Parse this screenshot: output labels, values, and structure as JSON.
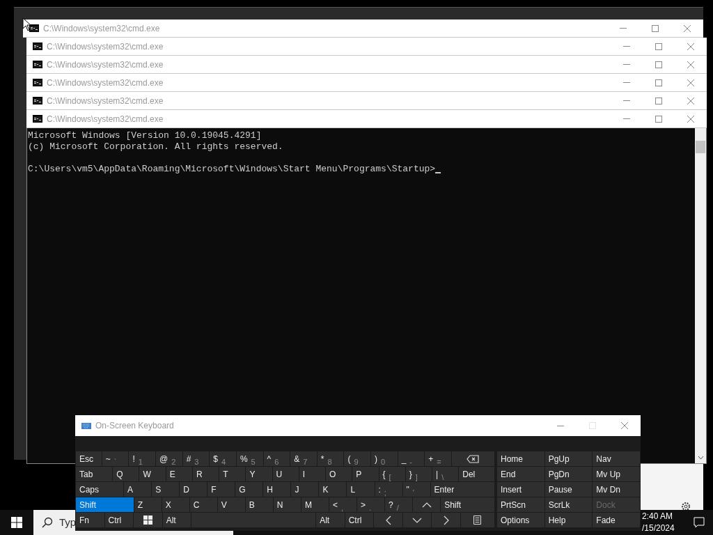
{
  "cmd_windows": [
    {
      "title": "C:\\Windows\\system32\\cmd.exe"
    },
    {
      "title": "C:\\Windows\\system32\\cmd.exe"
    },
    {
      "title": "C:\\Windows\\system32\\cmd.exe"
    },
    {
      "title": "C:\\Windows\\system32\\cmd.exe"
    },
    {
      "title": "C:\\Windows\\system32\\cmd.exe"
    },
    {
      "title": "C:\\Windows\\system32\\cmd.exe"
    }
  ],
  "console": {
    "blocks": [
      [
        "Microsoft Windows [Version 10.0.19045.4291]",
        "(c) Microsoft Corporation. All rights reserved."
      ],
      [
        "C:\\Users\\vm5\\AppData\\Roaming\\Microsoft\\Windows\\Start Menu\\Programs\\Startup>"
      ]
    ]
  },
  "keyboard": {
    "title": "On-Screen Keyboard",
    "key_rows": [
      {
        "keys": [
          {
            "kind": "text",
            "label": "Esc",
            "selected": false
          },
          {
            "kind": "text",
            "label": "~",
            "sub": "`",
            "selected": false
          },
          {
            "kind": "text",
            "label": "!",
            "sub": "1",
            "selected": false
          },
          {
            "kind": "text",
            "label": "@",
            "sub": "2",
            "selected": false
          },
          {
            "kind": "text",
            "label": "#",
            "sub": "3",
            "selected": false
          },
          {
            "kind": "text",
            "label": "$",
            "sub": "4",
            "selected": false
          },
          {
            "kind": "text",
            "label": "%",
            "sub": "5",
            "selected": false
          },
          {
            "kind": "text",
            "label": "^",
            "sub": "6",
            "selected": false
          },
          {
            "kind": "text",
            "label": "&",
            "sub": "7",
            "selected": false
          },
          {
            "kind": "text",
            "label": "*",
            "sub": "8",
            "selected": false
          },
          {
            "kind": "text",
            "label": "(",
            "sub": "9",
            "selected": false
          },
          {
            "kind": "text",
            "label": ")",
            "sub": "0",
            "selected": false
          },
          {
            "kind": "text",
            "label": "_",
            "sub": "-",
            "selected": false
          },
          {
            "kind": "text",
            "label": "+",
            "sub": "=",
            "selected": false
          },
          {
            "kind": "backspace",
            "selected": false
          }
        ]
      },
      {
        "keys": [
          {
            "kind": "text",
            "label": "Tab",
            "selected": false
          },
          {
            "kind": "text",
            "label": "Q",
            "selected": false
          },
          {
            "kind": "text",
            "label": "W",
            "selected": false
          },
          {
            "kind": "text",
            "label": "E",
            "selected": false
          },
          {
            "kind": "text",
            "label": "R",
            "selected": false
          },
          {
            "kind": "text",
            "label": "T",
            "selected": false
          },
          {
            "kind": "text",
            "label": "Y",
            "selected": false
          },
          {
            "kind": "text",
            "label": "U",
            "selected": false
          },
          {
            "kind": "text",
            "label": "I",
            "selected": false
          },
          {
            "kind": "text",
            "label": "O",
            "selected": false
          },
          {
            "kind": "text",
            "label": "P",
            "selected": false
          },
          {
            "kind": "text",
            "label": "{",
            "sub": "[",
            "selected": false
          },
          {
            "kind": "text",
            "label": "}",
            "sub": "]",
            "selected": false
          },
          {
            "kind": "text",
            "label": "|",
            "sub": "\\",
            "selected": false
          },
          {
            "kind": "text",
            "label": "Del",
            "selected": false
          }
        ]
      },
      {
        "keys": [
          {
            "kind": "text",
            "label": "Caps",
            "selected": false
          },
          {
            "kind": "text",
            "label": "A",
            "selected": false
          },
          {
            "kind": "text",
            "label": "S",
            "selected": false
          },
          {
            "kind": "text",
            "label": "D",
            "selected": false
          },
          {
            "kind": "text",
            "label": "F",
            "selected": false
          },
          {
            "kind": "text",
            "label": "G",
            "selected": false
          },
          {
            "kind": "text",
            "label": "H",
            "selected": false
          },
          {
            "kind": "text",
            "label": "J",
            "selected": false
          },
          {
            "kind": "text",
            "label": "K",
            "selected": false
          },
          {
            "kind": "text",
            "label": "L",
            "selected": false
          },
          {
            "kind": "text",
            "label": ":",
            "sub": ";",
            "selected": false
          },
          {
            "kind": "text",
            "label": "\"",
            "sub": "'",
            "selected": false
          },
          {
            "kind": "text",
            "label": "Enter",
            "selected": false
          }
        ]
      },
      {
        "keys": [
          {
            "kind": "text",
            "label": "Shift",
            "selected": true
          },
          {
            "kind": "text",
            "label": "Z",
            "selected": false
          },
          {
            "kind": "text",
            "label": "X",
            "selected": false
          },
          {
            "kind": "text",
            "label": "C",
            "selected": false
          },
          {
            "kind": "text",
            "label": "V",
            "selected": false
          },
          {
            "kind": "text",
            "label": "B",
            "selected": false
          },
          {
            "kind": "text",
            "label": "N",
            "selected": false
          },
          {
            "kind": "text",
            "label": "M",
            "selected": false
          },
          {
            "kind": "text",
            "label": "<",
            "sub": ",",
            "selected": false
          },
          {
            "kind": "text",
            "label": ">",
            "sub": ".",
            "selected": false
          },
          {
            "kind": "text",
            "label": "?",
            "sub": "/",
            "selected": false
          },
          {
            "kind": "up",
            "selected": false
          },
          {
            "kind": "text",
            "label": "Shift",
            "selected": false
          }
        ]
      },
      {
        "keys": [
          {
            "kind": "text",
            "label": "Fn",
            "selected": false
          },
          {
            "kind": "text",
            "label": "Ctrl",
            "selected": false
          },
          {
            "kind": "windows",
            "selected": false
          },
          {
            "kind": "text",
            "label": "Alt",
            "selected": false
          },
          {
            "kind": "space",
            "selected": false
          },
          {
            "kind": "text",
            "label": "Alt",
            "selected": false
          },
          {
            "kind": "text",
            "label": "Ctrl",
            "selected": false
          },
          {
            "kind": "left",
            "selected": false
          },
          {
            "kind": "down",
            "selected": false
          },
          {
            "kind": "right",
            "selected": false
          },
          {
            "kind": "menu",
            "selected": false
          }
        ]
      }
    ],
    "side_rows": [
      [
        {
          "label": "Home",
          "disabled": false
        },
        {
          "label": "PgUp",
          "disabled": false
        },
        {
          "label": "Nav",
          "disabled": false
        }
      ],
      [
        {
          "label": "End",
          "disabled": false
        },
        {
          "label": "PgDn",
          "disabled": false
        },
        {
          "label": "Mv Up",
          "disabled": false
        }
      ],
      [
        {
          "label": "Insert",
          "disabled": false
        },
        {
          "label": "Pause",
          "disabled": false
        },
        {
          "label": "Mv Dn",
          "disabled": false
        }
      ],
      [
        {
          "label": "PrtScn",
          "disabled": false
        },
        {
          "label": "ScrLk",
          "disabled": false
        },
        {
          "label": "Dock",
          "disabled": true
        }
      ],
      [
        {
          "label": "Options",
          "disabled": false
        },
        {
          "label": "Help",
          "disabled": false
        },
        {
          "label": "Fade",
          "disabled": false
        }
      ]
    ]
  },
  "taskbar": {
    "search": {
      "placeholder": "Typ"
    },
    "time": "2:40 AM",
    "date": "/15/2024"
  }
}
